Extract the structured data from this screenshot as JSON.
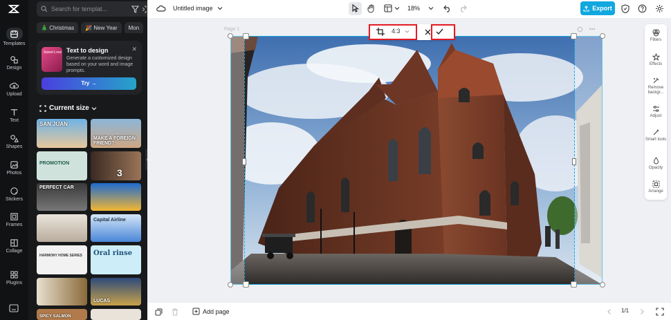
{
  "nav": {
    "items": [
      {
        "label": "Templates"
      },
      {
        "label": "Design"
      },
      {
        "label": "Upload"
      },
      {
        "label": "Text"
      },
      {
        "label": "Shapes"
      },
      {
        "label": "Photos"
      },
      {
        "label": "Stickers"
      },
      {
        "label": "Frames"
      },
      {
        "label": "Collage"
      },
      {
        "label": "Plugins"
      }
    ]
  },
  "panel": {
    "search_placeholder": "Search for templat...",
    "chips": [
      "Christmas",
      "New Year",
      "Mon"
    ],
    "promo": {
      "title": "Text to design",
      "description": "Generate a customized design based on your word and image prompts.",
      "thumb_text": "Sweet Love",
      "try_label": "Try →"
    },
    "current_size_label": "Current size",
    "templates": [
      {
        "text": "SAN JUAN",
        "color": "#4a8fc4"
      },
      {
        "text": "MAKE A FOREIGN FRIEND?",
        "color": "#6fa0c8"
      },
      {
        "text": "PROMOTION",
        "color": "#cfe3dc"
      },
      {
        "text": "3",
        "color": "#7a5a44"
      },
      {
        "text": "PERFECT CAR",
        "color": "#2b2b2b"
      },
      {
        "text": "",
        "color": "#1f6bd0"
      },
      {
        "text": "",
        "color": "#d7d0c7"
      },
      {
        "text": "Capital Airline",
        "color": "#d4e6f7"
      },
      {
        "text": "HARMONY HOME SERIES",
        "color": "#f2f2f2"
      },
      {
        "text": "Oral rinse",
        "color": "#cdeef8"
      },
      {
        "text": "",
        "color": "#e8e0cf"
      },
      {
        "text": "LUCAS",
        "color": "#2d4a7a"
      },
      {
        "text": "SPICY SALMON",
        "color": "#b07a4a"
      },
      {
        "text": "",
        "color": "#e9e3da"
      }
    ]
  },
  "topbar": {
    "doc_title": "Untitled image",
    "zoom": "18%",
    "export_label": "Export"
  },
  "canvas": {
    "page_label": "Page 1",
    "ratio_label": "4:3"
  },
  "right_tools": [
    {
      "label": "Filters"
    },
    {
      "label": "Effects"
    },
    {
      "label": "Remove backgr..."
    },
    {
      "label": "Adjust"
    },
    {
      "label": "Smart tools"
    },
    {
      "label": "Opacity"
    },
    {
      "label": "Arrange"
    }
  ],
  "bottombar": {
    "add_page_label": "Add page",
    "page_counter": "1/1"
  },
  "colors": {
    "accent": "#12a7df",
    "highlight": "#e31b23",
    "crop_guide": "#12a7df"
  }
}
